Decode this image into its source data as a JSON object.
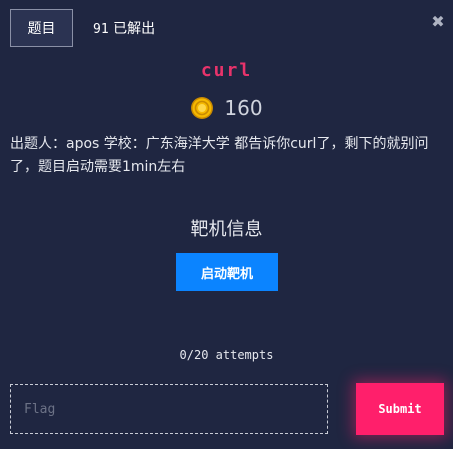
{
  "header": {
    "tab_label": "题目",
    "solves_count": "91",
    "solves_label": "已解出",
    "close_glyph": "✖"
  },
  "challenge": {
    "title": "curl",
    "points": "160",
    "description": "出题人：apos 学校：广东海洋大学 都告诉你curl了，剩下的就别问了，题目启动需要1min左右"
  },
  "target": {
    "section_title": "靶机信息",
    "start_button_label": "启动靶机"
  },
  "submission": {
    "attempts": "0/20 attempts",
    "flag_placeholder": "Flag",
    "flag_value": "",
    "submit_label": "Submit"
  },
  "colors": {
    "background": "#1f2641",
    "title_accent": "#e8336b",
    "start_button": "#0b84ff",
    "submit_button": "#ff1f6b",
    "coin": "#f5b800"
  },
  "icons": {
    "close": "close-icon",
    "points": "coin-icon"
  }
}
